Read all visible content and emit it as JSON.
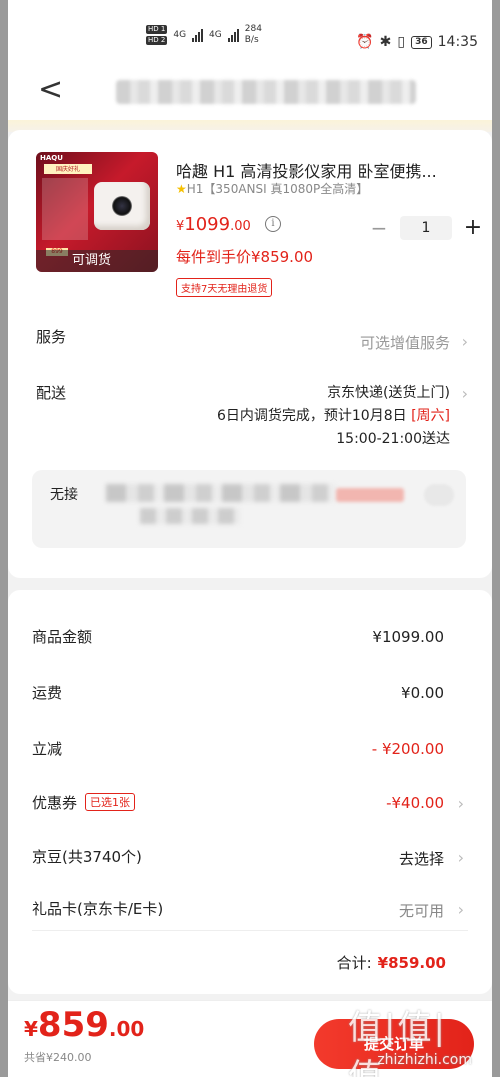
{
  "status_bar": {
    "hd1": "HD 1",
    "hd2": "HD 2",
    "net1": "4G",
    "net2": "4G",
    "speed_value": "284",
    "speed_unit": "B/s",
    "battery": "36",
    "time": "14:35"
  },
  "nav": {
    "back_icon": "chevron-left-icon",
    "address": ""
  },
  "product": {
    "title": "哈趣 H1 高清投影仪家用 卧室便携...",
    "spec": "H1【350ANSI 真1080P全高清】",
    "price_currency": "¥",
    "price_int": "1099",
    "price_dec": ".00",
    "info_icon": "i",
    "qty_minus": "−",
    "qty": "1",
    "qty_plus": "+",
    "unit_price": "每件到手价¥859.00",
    "return_tag": "支持7天无理由退货",
    "thumb": {
      "logo": "HAQU",
      "tagline": "国庆好礼",
      "chip": "899",
      "transfer_label": "可调货"
    }
  },
  "service": {
    "label": "服务",
    "value": "可选增值服务"
  },
  "delivery": {
    "label": "配送",
    "method": "京东快递(送货上门)",
    "eta_prefix": "6日内调货完成，预计10月8日",
    "weekday": "[周六]",
    "time_window": "15:00-21:00送达"
  },
  "contactless": {
    "label": "无接"
  },
  "costs": {
    "goods_label": "商品金额",
    "goods_value": "¥1099.00",
    "shipping_label": "运费",
    "shipping_value": "¥0.00",
    "discount_label": "立减",
    "discount_value": "- ¥200.00",
    "coupon_label": "优惠券",
    "coupon_tag": "已选1张",
    "coupon_value": "-¥40.00",
    "jd_bean_label": "京豆(共3740个)",
    "jd_bean_value": "去选择",
    "gift_card_label": "礼品卡(京东卡/E卡)",
    "gift_card_value": "无可用",
    "total_label": "合计:",
    "total_value": "¥859.00"
  },
  "bottom": {
    "currency": "¥",
    "price_int": "859",
    "price_dec": ".00",
    "saved": "共省¥240.00",
    "submit": "提交订单"
  },
  "watermark": {
    "big": "值|值|值",
    "small": "zhizhizhi.com"
  },
  "colors": {
    "accent": "#e2231a",
    "background": "#f2f2f2"
  }
}
